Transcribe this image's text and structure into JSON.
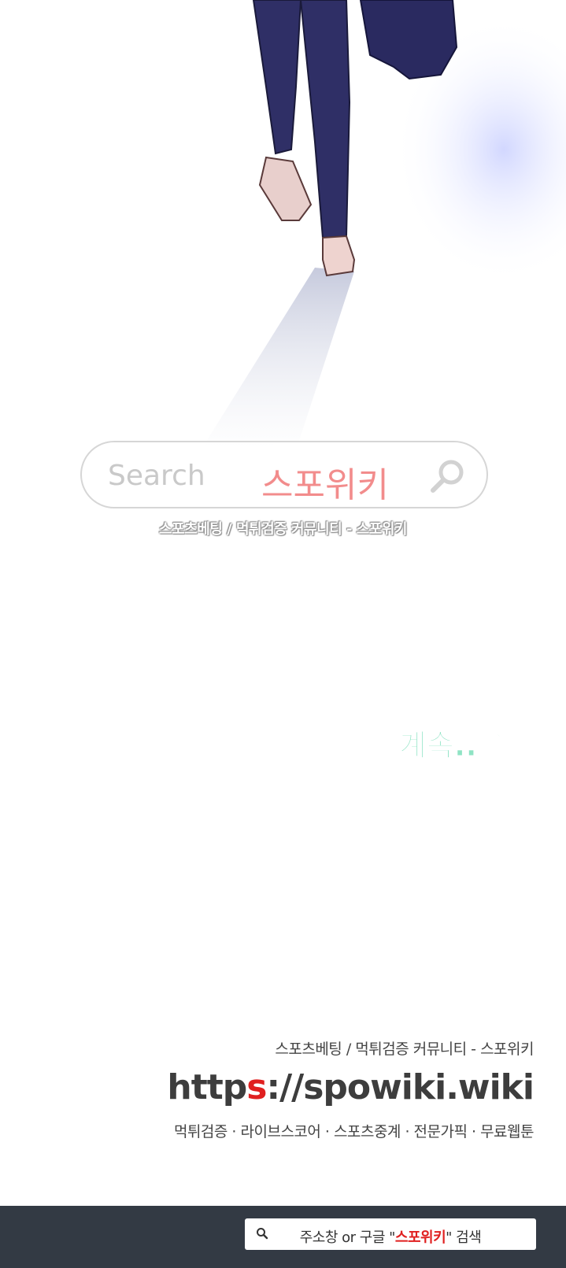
{
  "watermark": {
    "placeholder": "Search",
    "brand": "스포위키",
    "tagline": "스포츠베팅 / 먹튀검증 커뮤니티 - 스포위키"
  },
  "continue_text": "계속..♡",
  "footer": {
    "line1": "스포츠베팅 / 먹튀검증 커뮤니티 - 스포위키",
    "url_prefix": "http",
    "url_highlight": "s",
    "url_suffix": "://spowiki.wiki",
    "line3": "먹튀검증 · 라이브스코어 · 스포츠중계 · 전문가픽 · 무료웹툰"
  },
  "search_bar": {
    "pre": "주소창 or 구글 \"",
    "brand": "스포위키",
    "post": "\" 검색"
  },
  "colors": {
    "accent_red": "#e02020",
    "dark_bar": "#333a44",
    "continue_green": "#8fe3c4"
  }
}
